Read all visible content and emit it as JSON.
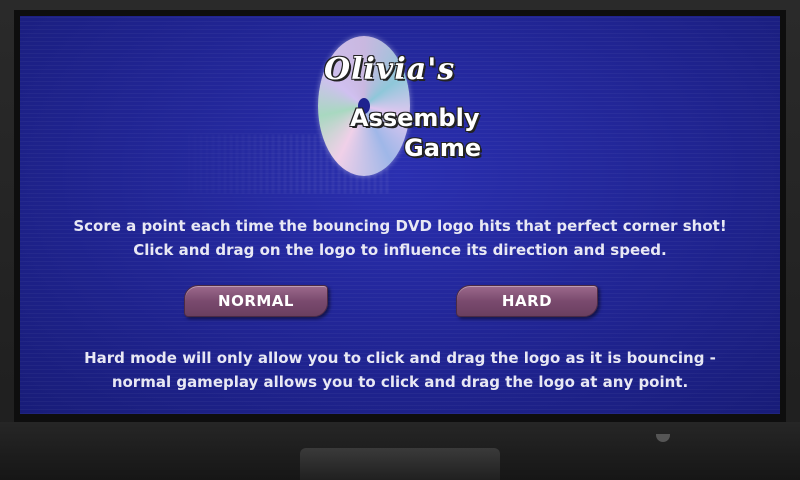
{
  "logo": {
    "line1": "Olivia's",
    "line2": "Assembly",
    "line3": "Game"
  },
  "description": {
    "line1": "Score a point each time the bouncing DVD logo hits that perfect corner shot!",
    "line2": "Click and drag on the logo to influence its direction and speed."
  },
  "buttons": {
    "normal": "NORMAL",
    "hard": "HARD"
  },
  "footer": {
    "line1": "Hard mode will only allow you to click and drag the logo as it is bouncing -",
    "line2": "normal gameplay allows you to click and drag the logo at any point."
  },
  "colors": {
    "screen": "#1f238f",
    "button": "#7a4a6e",
    "text": "#e8e8f4"
  }
}
